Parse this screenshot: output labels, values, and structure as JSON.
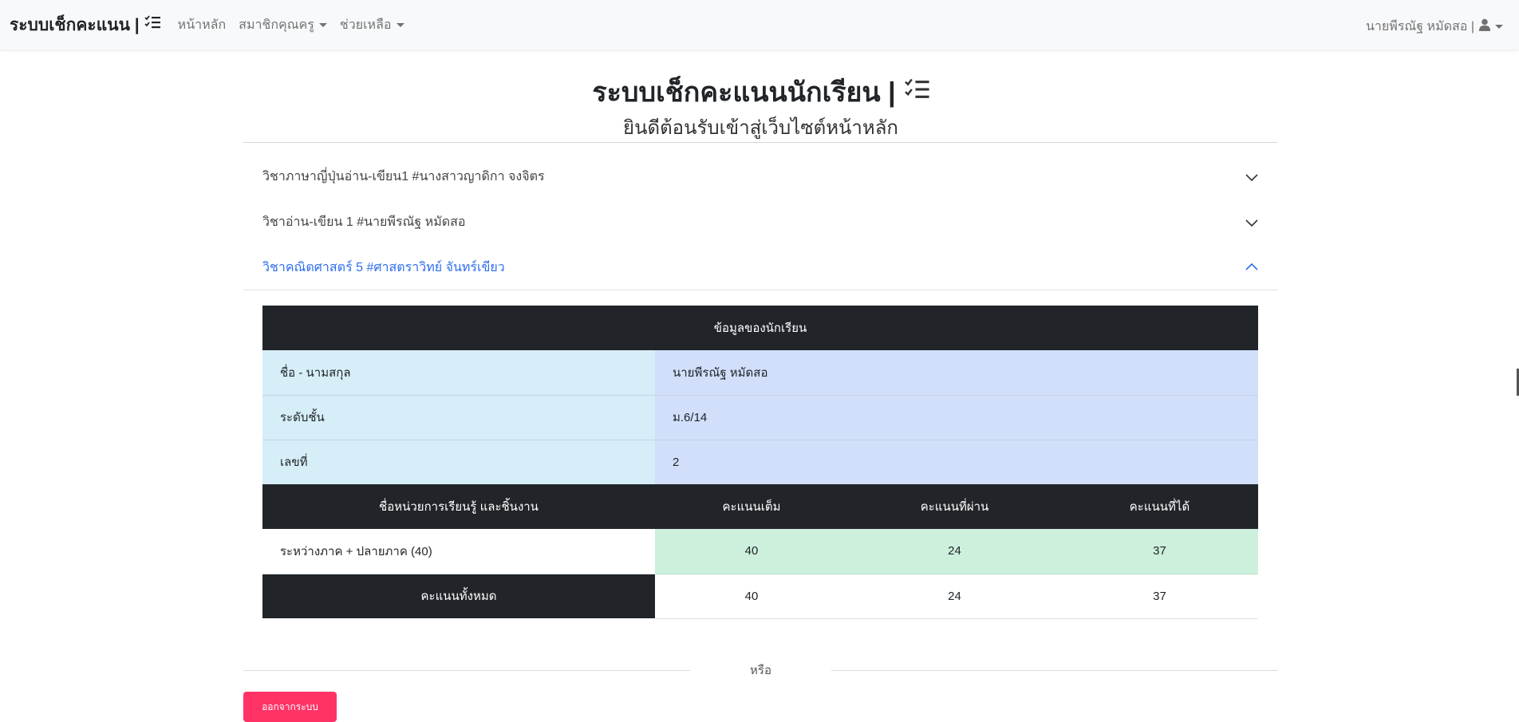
{
  "navbar": {
    "brand": "ระบบเช็กคะแนน |",
    "brand_icon": "checklist-icon",
    "links": [
      {
        "label": "หน้าหลัก",
        "dropdown": false
      },
      {
        "label": "สมาชิกคุณครู",
        "dropdown": true
      },
      {
        "label": "ช่วยเหลือ",
        "dropdown": true
      }
    ],
    "user": "นายพีรณัฐ หมัดสอ |",
    "user_icon": "user-icon"
  },
  "header": {
    "title": "ระบบเช็กคะแนนนักเรียน |",
    "subtitle": "ยินดีต้อนรับเข้าสู่เว็บไซต์หน้าหลัก"
  },
  "accordion": [
    {
      "label": "วิชาภาษาญี่ปุ่นอ่าน-เขียน1 #นางสาวญาดิกา จงจิตร",
      "expanded": false
    },
    {
      "label": "วิชาอ่าน-เขียน 1 #นายพีรณัฐ หมัดสอ",
      "expanded": false
    },
    {
      "label": "วิชาคณิตศาสตร์ 5 #ศาสตราวิทย์ จันทร์เขียว",
      "expanded": true
    }
  ],
  "student_table": {
    "header": "ข้อมูลของนักเรียน",
    "info": [
      {
        "label": "ชื่อ - นามสกุล",
        "value": "นายพีรณัฐ หมัดสอ"
      },
      {
        "label": "ระดับชั้น",
        "value": "ม.6/14"
      },
      {
        "label": "เลขที่",
        "value": "2"
      }
    ],
    "columns": [
      "ชื่อหน่วยการเรียนรู้ และชิ้นงาน",
      "คะแนนเต็ม",
      "คะแนนที่ผ่าน",
      "คะแนนที่ได้"
    ],
    "rows": [
      {
        "name": "ระหว่างภาค + ปลายภาค (40)",
        "full": "40",
        "pass": "24",
        "got": "37"
      }
    ],
    "total": {
      "label": "คะแนนทั้งหมด",
      "full": "40",
      "pass": "24",
      "got": "37"
    }
  },
  "or_text": "หรือ",
  "logout_label": "ออกจากระบบ",
  "colors": {
    "accent": "#2f6fed",
    "danger": "#ff3366",
    "dark": "#212529",
    "success_row": "#cdf0dc"
  }
}
